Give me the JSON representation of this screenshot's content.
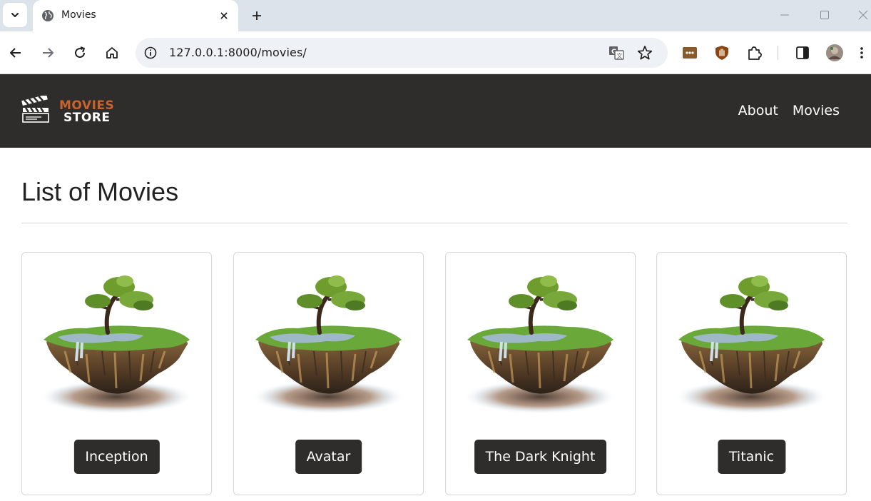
{
  "browser": {
    "tab_title": "Movies",
    "url": "127.0.0.1:8000/movies/"
  },
  "site": {
    "logo_line1": "MOVIES",
    "logo_line2": "STORE",
    "nav": [
      {
        "label": "About"
      },
      {
        "label": "Movies"
      }
    ]
  },
  "page": {
    "title": "List of Movies"
  },
  "movies": [
    {
      "title": "Inception"
    },
    {
      "title": "Avatar"
    },
    {
      "title": "The Dark Knight"
    },
    {
      "title": "Titanic"
    }
  ],
  "colors": {
    "header_bg": "#2e2d2b",
    "logo_accent": "#c8632d",
    "button_bg": "#2e2d2b"
  }
}
